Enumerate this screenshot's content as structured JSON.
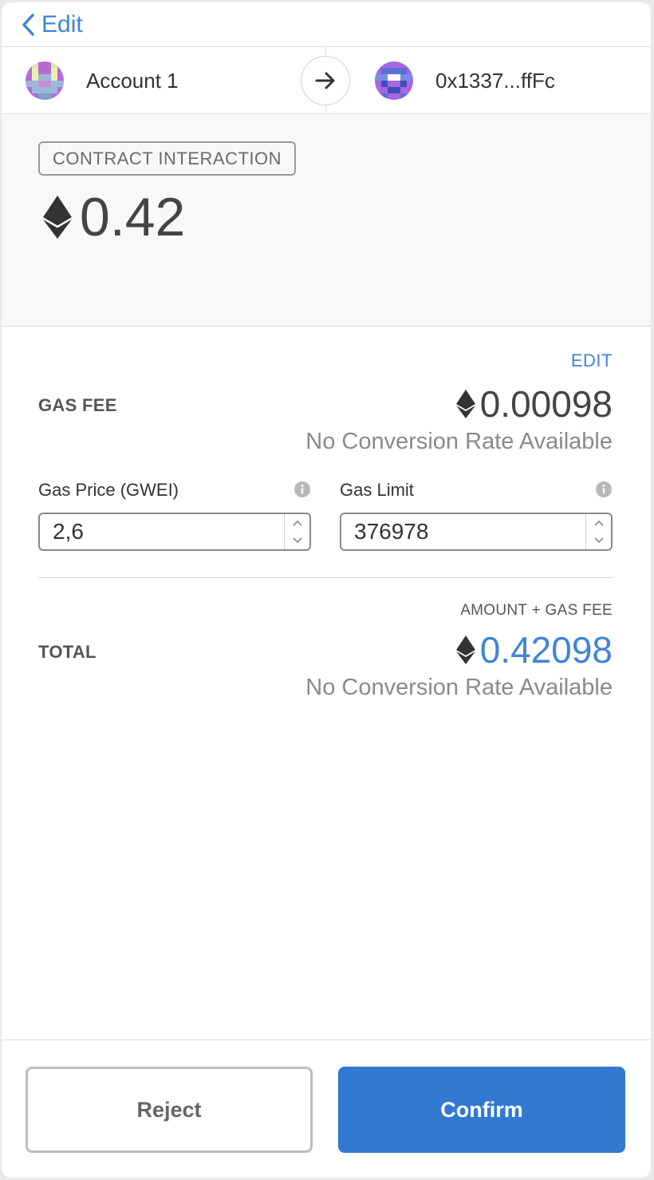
{
  "header": {
    "back_label": "Edit"
  },
  "accounts": {
    "from_name": "Account 1",
    "to_name": "0x1337...ffFc"
  },
  "summary": {
    "badge": "CONTRACT INTERACTION",
    "amount": "0.42"
  },
  "details": {
    "edit_label": "EDIT",
    "gas_fee_label": "GAS FEE",
    "gas_fee_value": "0.00098",
    "gas_fee_conversion": "No Conversion Rate Available",
    "gas_price_label": "Gas Price (GWEI)",
    "gas_price_value": "2,6",
    "gas_limit_label": "Gas Limit",
    "gas_limit_value": "376978",
    "total_caption": "AMOUNT + GAS FEE",
    "total_label": "TOTAL",
    "total_value": "0.42098",
    "total_conversion": "No Conversion Rate Available"
  },
  "footer": {
    "reject_label": "Reject",
    "confirm_label": "Confirm"
  },
  "colors": {
    "accent": "#3f84d6",
    "confirm_bg": "#3279d2",
    "summary_bg": "#f7f8f8"
  }
}
